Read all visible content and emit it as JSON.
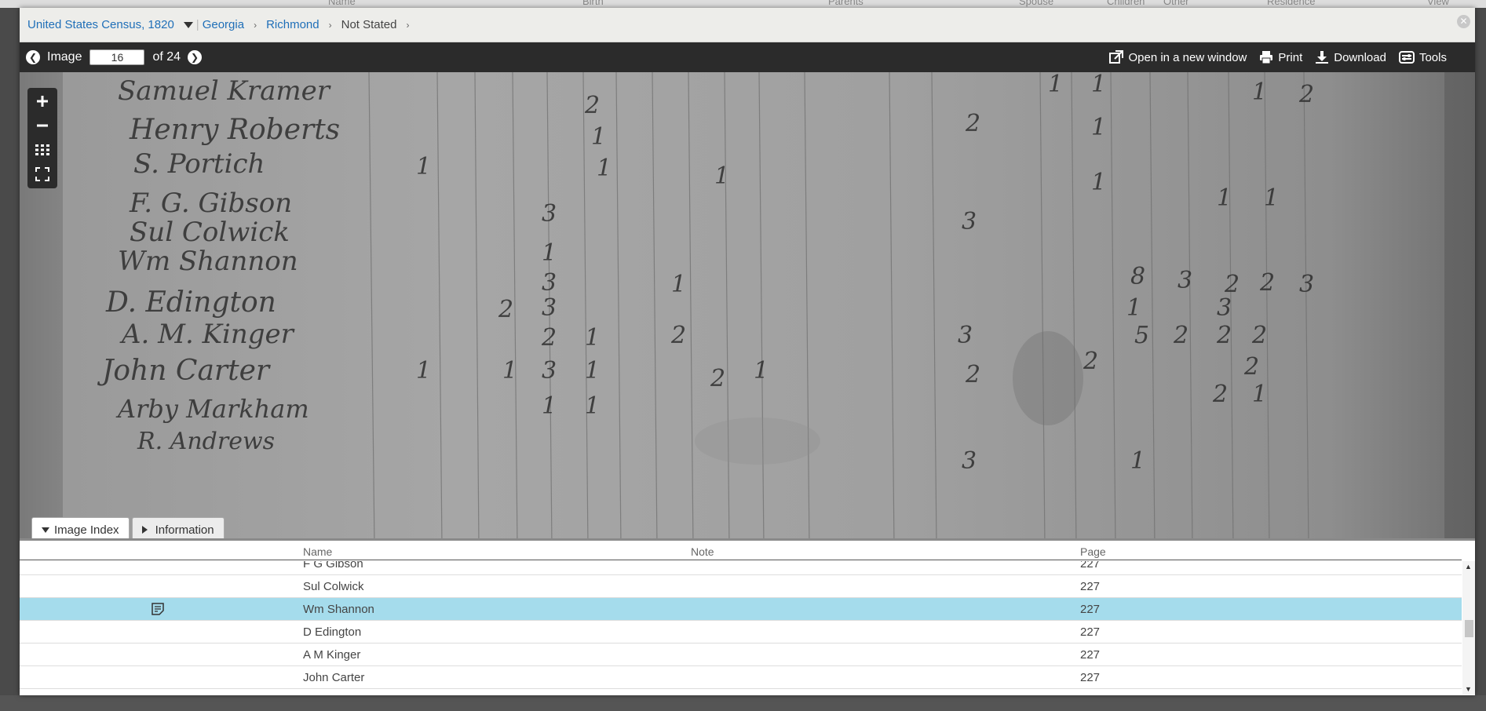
{
  "background": {
    "columns": [
      "Name",
      "Birth",
      "Parents",
      "Spouse",
      "Children",
      "Other",
      "Residence",
      "View"
    ]
  },
  "breadcrumb": {
    "collection": "United States Census, 1820",
    "items": [
      "Georgia",
      "Richmond",
      "Not Stated"
    ]
  },
  "toolbar": {
    "image_label": "Image",
    "current_image": "16",
    "total_label": "of 24",
    "open_new_window": "Open in a new window",
    "print": "Print",
    "download": "Download",
    "tools": "Tools"
  },
  "tabs": {
    "image_index": "Image Index",
    "information": "Information"
  },
  "index_table": {
    "columns": {
      "name": "Name",
      "note": "Note",
      "page": "Page"
    },
    "rows": [
      {
        "name": "F G Gibson",
        "page": "227",
        "selected": false
      },
      {
        "name": "Sul Colwick",
        "page": "227",
        "selected": false
      },
      {
        "name": "Wm Shannon",
        "page": "227",
        "selected": true,
        "has_note": true
      },
      {
        "name": "D Edington",
        "page": "227",
        "selected": false
      },
      {
        "name": "A M Kinger",
        "page": "227",
        "selected": false
      },
      {
        "name": "John Carter",
        "page": "227",
        "selected": false
      }
    ]
  },
  "colors": {
    "link": "#1f6fb8",
    "toolbar_bg": "#2b2b2b",
    "selected_row": "#a5dcec"
  }
}
